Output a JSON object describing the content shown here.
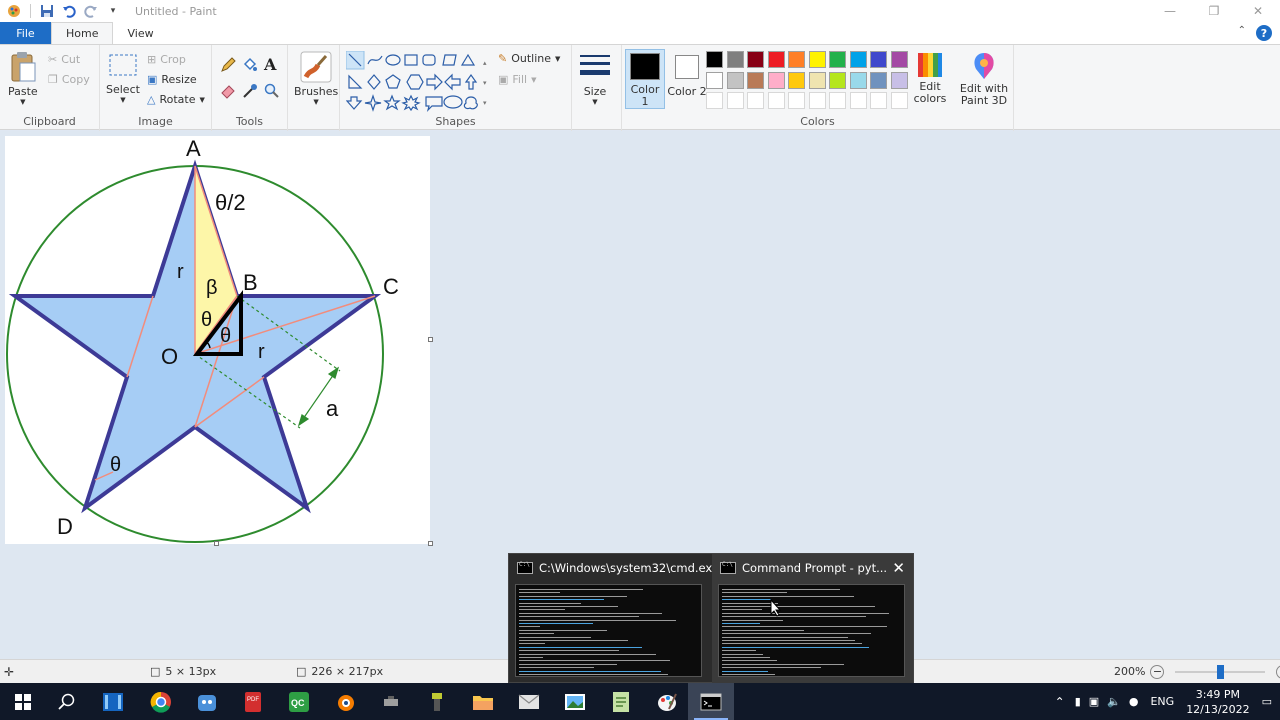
{
  "window": {
    "title": "Untitled - Paint",
    "controls": [
      "—",
      "❐",
      "✕"
    ]
  },
  "tabs": [
    "File",
    "Home",
    "View"
  ],
  "ribbon": {
    "clipboard": {
      "paste": "Paste",
      "cut": "Cut",
      "copy": "Copy",
      "label": "Clipboard"
    },
    "image": {
      "select": "Select",
      "crop": "Crop",
      "resize": "Resize",
      "rotate": "Rotate",
      "label": "Image"
    },
    "tools": {
      "label": "Tools"
    },
    "brushes": {
      "label": "Brushes"
    },
    "shapes": {
      "outline": "Outline",
      "fill": "Fill",
      "label": "Shapes"
    },
    "size": {
      "label": "Size"
    },
    "colors": {
      "color1": "Color 1",
      "color2": "Color 2",
      "color1_value": "#000000",
      "color2_value": "#ffffff",
      "edit_colors": "Edit colors",
      "edit_paint3d": "Edit with Paint 3D",
      "label": "Colors",
      "palette_row1": [
        "#000000",
        "#7f7f7f",
        "#880015",
        "#ed1c24",
        "#ff7f27",
        "#fff200",
        "#22b14c",
        "#00a2e8",
        "#3f48cc",
        "#a349a4"
      ],
      "palette_row2": [
        "#ffffff",
        "#c3c3c3",
        "#b97a57",
        "#ffaec9",
        "#ffc90e",
        "#efe4b0",
        "#b5e61d",
        "#99d9ea",
        "#7092be",
        "#c8bfe7"
      ]
    }
  },
  "drawing": {
    "vertices": [
      "A",
      "B",
      "C",
      "D",
      "O"
    ],
    "labels": [
      "θ/2",
      "r",
      "β",
      "θ",
      "θ",
      "r",
      "a",
      "θ"
    ],
    "colors": {
      "star_fill": "#a6cdf5",
      "star_stroke": "#3d3a96",
      "circle": "#2e8b2e",
      "triangle_fill": "#fdf6a8",
      "aux_line": "#f28c7c"
    }
  },
  "statusbar": {
    "selection_size": "5 × 13px",
    "canvas_size": "226 × 217px",
    "zoom": "200%"
  },
  "thumbnails": [
    {
      "title": "C:\\Windows\\system32\\cmd.ex..."
    },
    {
      "title": "Command Prompt - pyt..."
    }
  ],
  "taskbar": {
    "language": "ENG",
    "time": "3:49 PM",
    "date": "12/13/2022"
  }
}
